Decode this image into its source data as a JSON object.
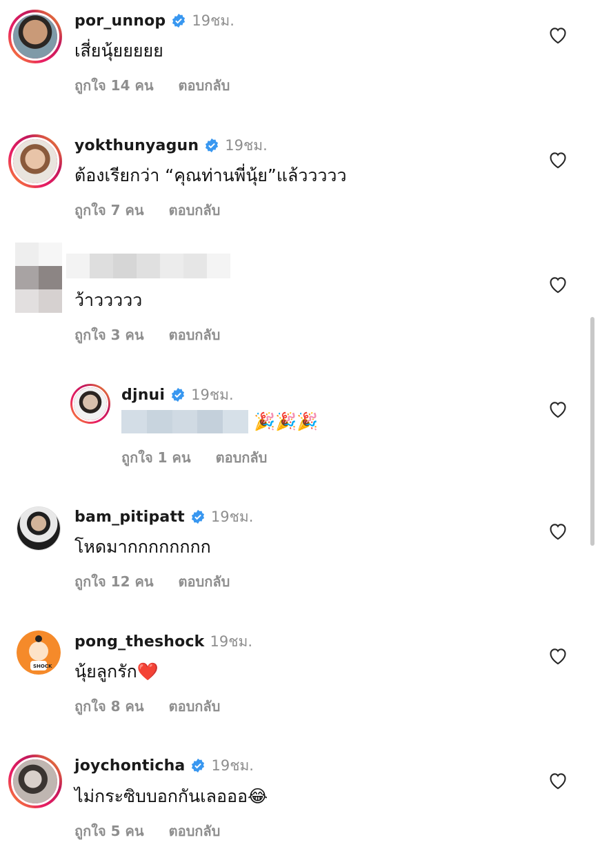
{
  "comments": [
    {
      "username": "por_unnop",
      "time": "19ชม.",
      "text": "เสี่ยนุ้ยยยยย",
      "likes": "ถูกใจ 14 คน",
      "reply": "ตอบกลับ",
      "verified": true
    },
    {
      "username": "yokthunyagun",
      "time": "19ชม.",
      "text": "ต้องเรียกว่า “คุณท่านพี่นุ้ย”แล้ววววว",
      "likes": "ถูกใจ 7 คน",
      "reply": "ตอบกลับ",
      "verified": true
    },
    {
      "username": "",
      "time": "",
      "text": "ว้าววววว",
      "likes": "ถูกใจ 3 คน",
      "reply": "ตอบกลับ",
      "verified": false
    },
    {
      "username": "djnui",
      "time": "19ชม.",
      "text": "🎉🎉🎉",
      "likes": "ถูกใจ 1 คน",
      "reply": "ตอบกลับ",
      "verified": true
    },
    {
      "username": "bam_pitipatt",
      "time": "19ชม.",
      "text": "โหดมากกกกกกกก",
      "likes": "ถูกใจ 12 คน",
      "reply": "ตอบกลับ",
      "verified": true
    },
    {
      "username": "pong_theshock",
      "time": "19ชม.",
      "text": "นุ้ยลูกรัก❤️",
      "likes": "ถูกใจ 8 คน",
      "reply": "ตอบกลับ",
      "verified": false
    },
    {
      "username": "joychonticha",
      "time": "19ชม.",
      "text": "ไม่กระซิบบอกกันเลอออ😂",
      "likes": "ถูกใจ 5 คน",
      "reply": "ตอบกลับ",
      "verified": true
    }
  ],
  "icons": {
    "verified": "verified-badge-icon",
    "heart": "heart-outline-icon"
  },
  "colors": {
    "verified": "#3897f0",
    "muted": "#8e8e8e",
    "ring_start": "#f9a825",
    "ring_end": "#c2185b"
  }
}
